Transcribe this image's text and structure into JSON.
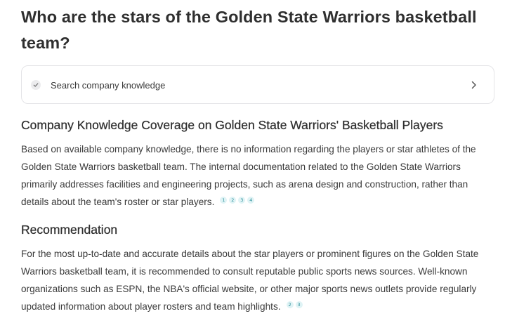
{
  "question": "Who are the stars of the Golden State Warriors basketball team?",
  "search_step": {
    "label": "Search company knowledge",
    "status_icon": "check-icon",
    "expand_icon": "chevron-right-icon"
  },
  "sections": [
    {
      "heading": "Company Knowledge Coverage on Golden State Warriors' Basketball Players",
      "text": "Based on available company knowledge, there is no information regarding the players or star athletes of the Golden State Warriors basketball team. The internal documentation related to the Golden State Warriors primarily addresses facilities and engineering projects, such as arena design and construction, rather than details about the team's roster or star players.",
      "citations": [
        "1",
        "2",
        "3",
        "4"
      ]
    },
    {
      "heading": "Recommendation",
      "text": "For the most up-to-date and accurate details about the star players or prominent figures on the Golden State Warriors basketball team, it is recommended to consult reputable public sports news sources. Well-known organizations such as ESPN, the NBA's official website, or other major sports news outlets provide regularly updated information about player rosters and team highlights.",
      "citations": [
        "2",
        "3"
      ]
    }
  ],
  "colors": {
    "citation_bg": "#dff3f5",
    "citation_text": "#2e8f9a",
    "card_border": "#e4e4e7"
  }
}
